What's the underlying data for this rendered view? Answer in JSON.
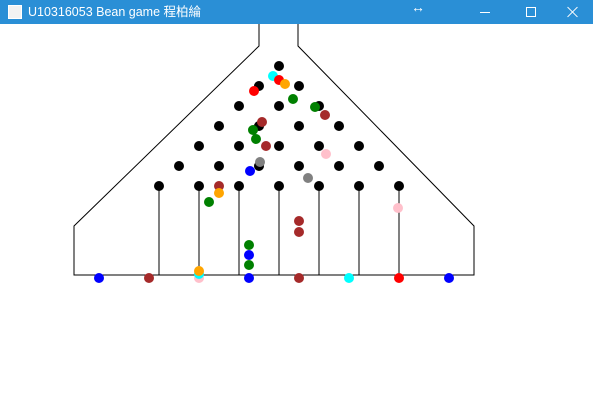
{
  "window": {
    "title": "U10316053 Bean game 程柏綸",
    "resize_cursor_glyph": "↔",
    "controls": [
      "minimize",
      "maximize",
      "close"
    ]
  },
  "board": {
    "frame_color": "#000000",
    "pegs": {
      "count": 28,
      "color": "#000000",
      "rows": [
        1,
        2,
        3,
        4,
        5,
        6,
        7
      ]
    },
    "slots": {
      "count": 8,
      "divider_count": 7
    },
    "falling_balls": [
      {
        "color": "#00ffff"
      },
      {
        "color": "#ff0000"
      },
      {
        "color": "#ff0000"
      },
      {
        "color": "#ffa500"
      },
      {
        "color": "#008000"
      },
      {
        "color": "#008000"
      },
      {
        "color": "#a52a2a"
      },
      {
        "color": "#008000"
      },
      {
        "color": "#008000"
      },
      {
        "color": "#a52a2a"
      },
      {
        "color": "#a52a2a"
      },
      {
        "color": "#ffc0cb"
      },
      {
        "color": "#808080"
      },
      {
        "color": "#0000ff"
      },
      {
        "color": "#808080"
      },
      {
        "color": "#a52a2a"
      },
      {
        "color": "#ffa500"
      },
      {
        "color": "#008000"
      },
      {
        "color": "#ffc0cb"
      }
    ],
    "slot_stacks": [
      {
        "slot": 1,
        "balls": [
          "#0000ff"
        ]
      },
      {
        "slot": 2,
        "balls": [
          "#a52a2a"
        ]
      },
      {
        "slot": 3,
        "balls": [
          "#ffc0cb",
          "#00ffff",
          "#ffa500"
        ]
      },
      {
        "slot": 4,
        "balls": [
          "#0000ff",
          "#008000",
          "#0000ff",
          "#008000"
        ]
      },
      {
        "slot": 5,
        "balls": [
          "#a52a2a",
          "#a52a2a",
          "#a52a2a"
        ]
      },
      {
        "slot": 6,
        "balls": [
          "#00ffff"
        ]
      },
      {
        "slot": 7,
        "balls": [
          "#ff0000"
        ]
      },
      {
        "slot": 8,
        "balls": [
          "#0000ff"
        ]
      }
    ]
  }
}
